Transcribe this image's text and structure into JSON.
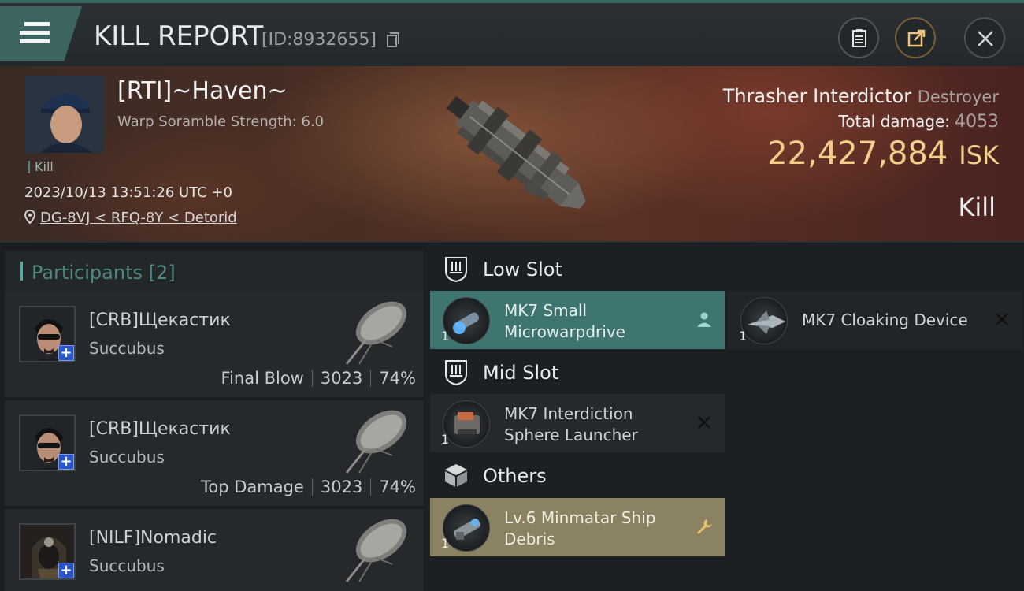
{
  "header": {
    "title": "KILL REPORT",
    "report_id": "[ID:8932655]"
  },
  "victim": {
    "name": "[RTI]~Haven~",
    "subtitle": "Warp Soramble Strength: 6.0",
    "kill_tag": "Kill",
    "timestamp": "2023/10/13 13:51:26 UTC +0",
    "location": "DG-8VJ < RFQ-8Y < Detorid"
  },
  "ship": {
    "name": "Thrasher Interdictor",
    "class": "Destroyer",
    "total_damage_label": "Total damage:",
    "total_damage_value": "4053",
    "isk_value": "22,427,884",
    "isk_unit": "ISK",
    "result": "Kill"
  },
  "participants": {
    "title": "Participants",
    "count": "[2]",
    "rows": [
      {
        "name": "[CRB]Щекастик",
        "ship": "Succubus",
        "role": "Final Blow",
        "damage": "3023",
        "percent": "74%"
      },
      {
        "name": "[CRB]Щекастик",
        "ship": "Succubus",
        "role": "Top Damage",
        "damage": "3023",
        "percent": "74%"
      },
      {
        "name": "[NILF]Nomadic",
        "ship": "Succubus",
        "role": "",
        "damage": "",
        "percent": ""
      }
    ]
  },
  "fitting": {
    "low_slot": {
      "label": "Low Slot",
      "modules": [
        {
          "qty": "1",
          "name": "MK7 Small Microwarpdrive",
          "state": "active"
        },
        {
          "qty": "1",
          "name": "MK7 Cloaking Device",
          "state": "destroyed"
        }
      ]
    },
    "mid_slot": {
      "label": "Mid Slot",
      "modules": [
        {
          "qty": "1",
          "name": "MK7 Interdiction Sphere Launcher",
          "state": "destroyed"
        }
      ]
    },
    "others": {
      "label": "Others",
      "modules": [
        {
          "qty": "1",
          "name": "Lv.6 Minmatar Ship Debris",
          "state": "debris"
        }
      ]
    }
  },
  "colors": {
    "accent": "#3e7570",
    "isk": "#f4cf8b",
    "debris": "#8b8262",
    "player_badge": "#2a55c7"
  },
  "icons": {
    "menu": "menu-icon",
    "copy": "copy-icon",
    "report": "clipboard-icon",
    "share": "share-icon",
    "close": "close-icon",
    "location": "map-pin-icon",
    "slot": "shield-slot-icon",
    "others": "cube-icon",
    "active_module": "person-icon",
    "destroyed_module": "x-icon",
    "debris_module": "wrench-icon"
  }
}
